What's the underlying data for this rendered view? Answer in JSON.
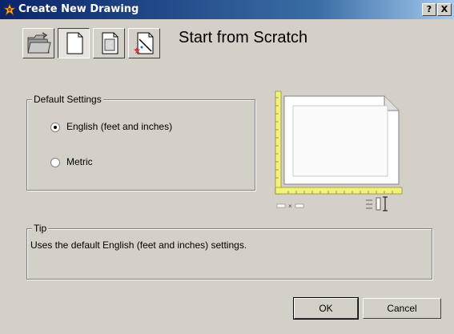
{
  "window": {
    "title": "Create New Drawing",
    "help_btn": "?",
    "close_btn": "X"
  },
  "toolbar": {
    "heading": "Start from Scratch"
  },
  "default_settings": {
    "label": "Default Settings",
    "options": [
      {
        "label": "English (feet and inches)",
        "selected": true
      },
      {
        "label": "Metric",
        "selected": false
      }
    ]
  },
  "tip": {
    "label": "Tip",
    "text": "Uses the default English (feet and inches) settings."
  },
  "buttons": {
    "ok": "OK",
    "cancel": "Cancel"
  },
  "colors": {
    "ruler": "#f2f27a",
    "title_left": "#0a246a",
    "title_right": "#a6caf0"
  }
}
